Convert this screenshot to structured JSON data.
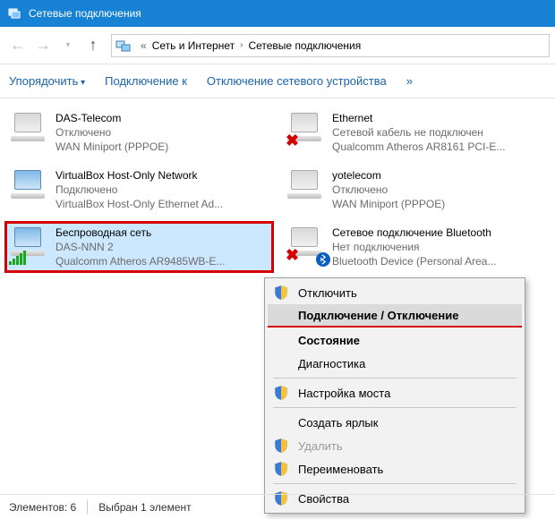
{
  "window": {
    "title": "Сетевые подключения"
  },
  "breadcrumb": {
    "prefix": "«",
    "part1": "Сеть и Интернет",
    "part2": "Сетевые подключения"
  },
  "toolbar": {
    "organize": "Упорядочить",
    "connect": "Подключение к",
    "disable": "Отключение сетевого устройства",
    "overflow": "»"
  },
  "items": [
    {
      "title": "DAS-Telecom",
      "line2": "Отключено",
      "line3": "WAN Miniport (PPPOE)",
      "gray": true
    },
    {
      "title": "Ethernet",
      "line2": "Сетевой кабель не подключен",
      "line3": "Qualcomm Atheros AR8161 PCI-E...",
      "gray": true,
      "x": true
    },
    {
      "title": "VirtualBox Host-Only Network",
      "line2": "Подключено",
      "line3": "VirtualBox Host-Only Ethernet Ad..."
    },
    {
      "title": "yotelecom",
      "line2": "Отключено",
      "line3": "WAN Miniport (PPPOE)",
      "gray": true
    },
    {
      "title": "Беспроводная сеть",
      "line2": "DAS-NNN  2",
      "line3": "Qualcomm Atheros AR9485WB-E...",
      "selected": true,
      "signal": true
    },
    {
      "title": "Сетевое подключение Bluetooth",
      "line2": "Нет подключения",
      "line3": "Bluetooth Device (Personal Area...",
      "gray": true,
      "x": true,
      "bt": true
    }
  ],
  "context_menu": [
    {
      "label": "Отключить",
      "shield": true
    },
    {
      "label": "Подключение / Отключение",
      "bold": true,
      "hovered": true,
      "underlined": true
    },
    {
      "label": "Состояние",
      "bold": true
    },
    {
      "label": "Диагностика"
    },
    {
      "sep": true
    },
    {
      "label": "Настройка моста",
      "shield": true
    },
    {
      "sep": true
    },
    {
      "label": "Создать ярлык"
    },
    {
      "label": "Удалить",
      "shield": true,
      "disabled": true
    },
    {
      "label": "Переименовать",
      "shield": true
    },
    {
      "sep": true
    },
    {
      "label": "Свойства",
      "shield": true
    }
  ],
  "status": {
    "elements": "Элементов: 6",
    "selected": "Выбран 1 элемент"
  }
}
